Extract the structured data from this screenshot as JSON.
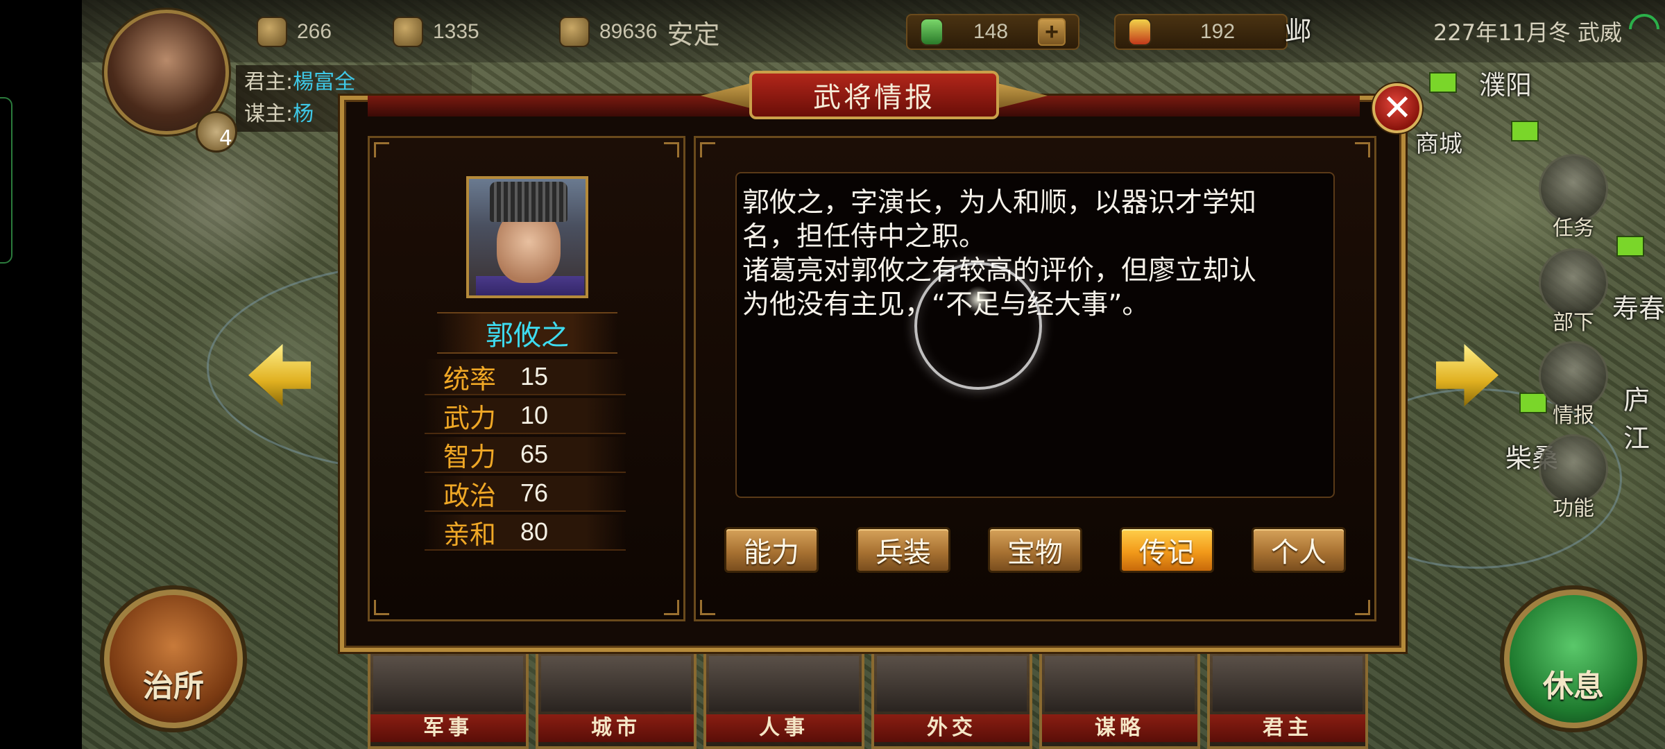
{
  "resources": {
    "r1": "266",
    "r2": "1335",
    "r3": "89636",
    "status": "安定",
    "jade": "148",
    "token": "192"
  },
  "date": "227年11月冬 武威",
  "lord": {
    "lord_label": "君主:",
    "lord_name": "楊富全",
    "advisor_label": "谋主:",
    "advisor_name": "杨",
    "level": "4"
  },
  "map_labels": [
    "濮阳",
    "商城",
    "寿春",
    "庐江",
    "柴桑",
    "邺"
  ],
  "side_menu": [
    "任务",
    "部下",
    "情报",
    "功能"
  ],
  "bottom_tabs": [
    "军事",
    "城市",
    "人事",
    "外交",
    "谋略",
    "君主"
  ],
  "round_buttons": {
    "left": "治所",
    "right": "休息"
  },
  "dialog": {
    "title": "武将情报",
    "general_name": "郭攸之",
    "stats": [
      {
        "label": "统率",
        "value": "15"
      },
      {
        "label": "武力",
        "value": "10"
      },
      {
        "label": "智力",
        "value": "65"
      },
      {
        "label": "政治",
        "value": "76"
      },
      {
        "label": "亲和",
        "value": "80"
      }
    ],
    "biography": "郭攸之，字演长，为人和顺，以器识才学知\n名，担任侍中之职。\n诸葛亮对郭攸之有较高的评价，但廖立却认\n为他没有主见，“不足与经大事”。",
    "tabs": [
      "能力",
      "兵装",
      "宝物",
      "传记",
      "个人"
    ],
    "active_tab": "传记"
  },
  "colors": {
    "stat_label": "#f0a826",
    "name": "#3edcf0",
    "lord_value": "#3ec9e8",
    "dialog_title_bg": "#b2261a",
    "active_tab": "#f29a1a"
  }
}
